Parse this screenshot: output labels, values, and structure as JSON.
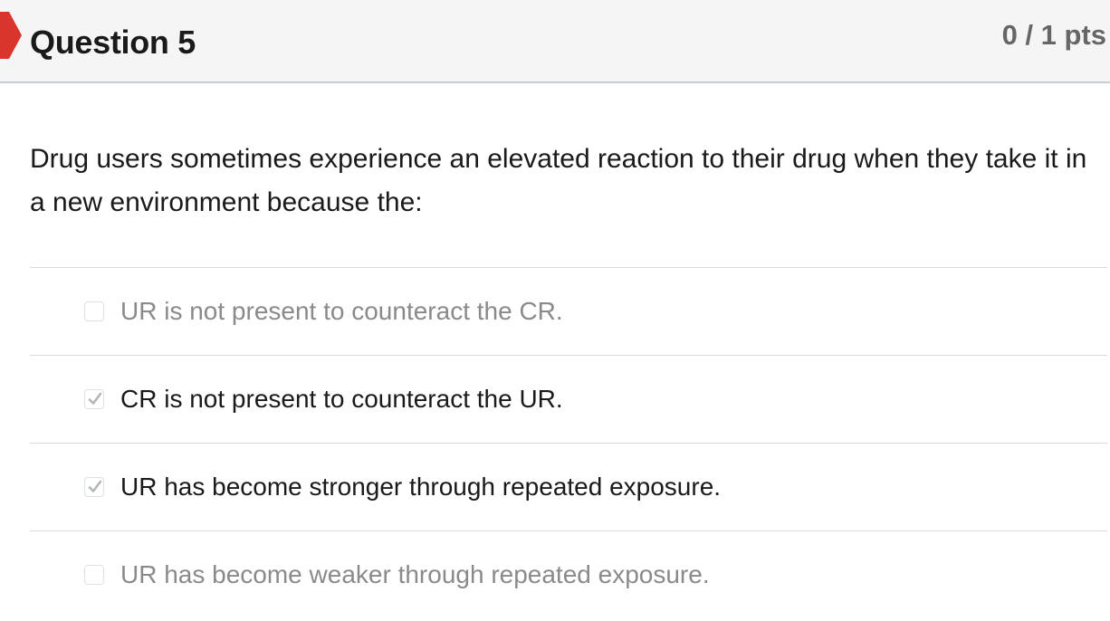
{
  "header": {
    "title": "Question 5",
    "points": "0 / 1 pts",
    "flag_color": "#d9352d"
  },
  "question": {
    "text": "Drug users sometimes experience an elevated reaction to their drug when they take it in a new environment because the:"
  },
  "answers": [
    {
      "label": "UR is not present to counteract the CR.",
      "selected": false
    },
    {
      "label": "CR is not present to counteract the UR.",
      "selected": true
    },
    {
      "label": "UR has become stronger through repeated exposure.",
      "selected": true
    },
    {
      "label": "UR has become weaker through repeated exposure.",
      "selected": false
    }
  ],
  "icons": {
    "flag": "bookmark-flag-icon",
    "check": "checkmark-icon"
  }
}
